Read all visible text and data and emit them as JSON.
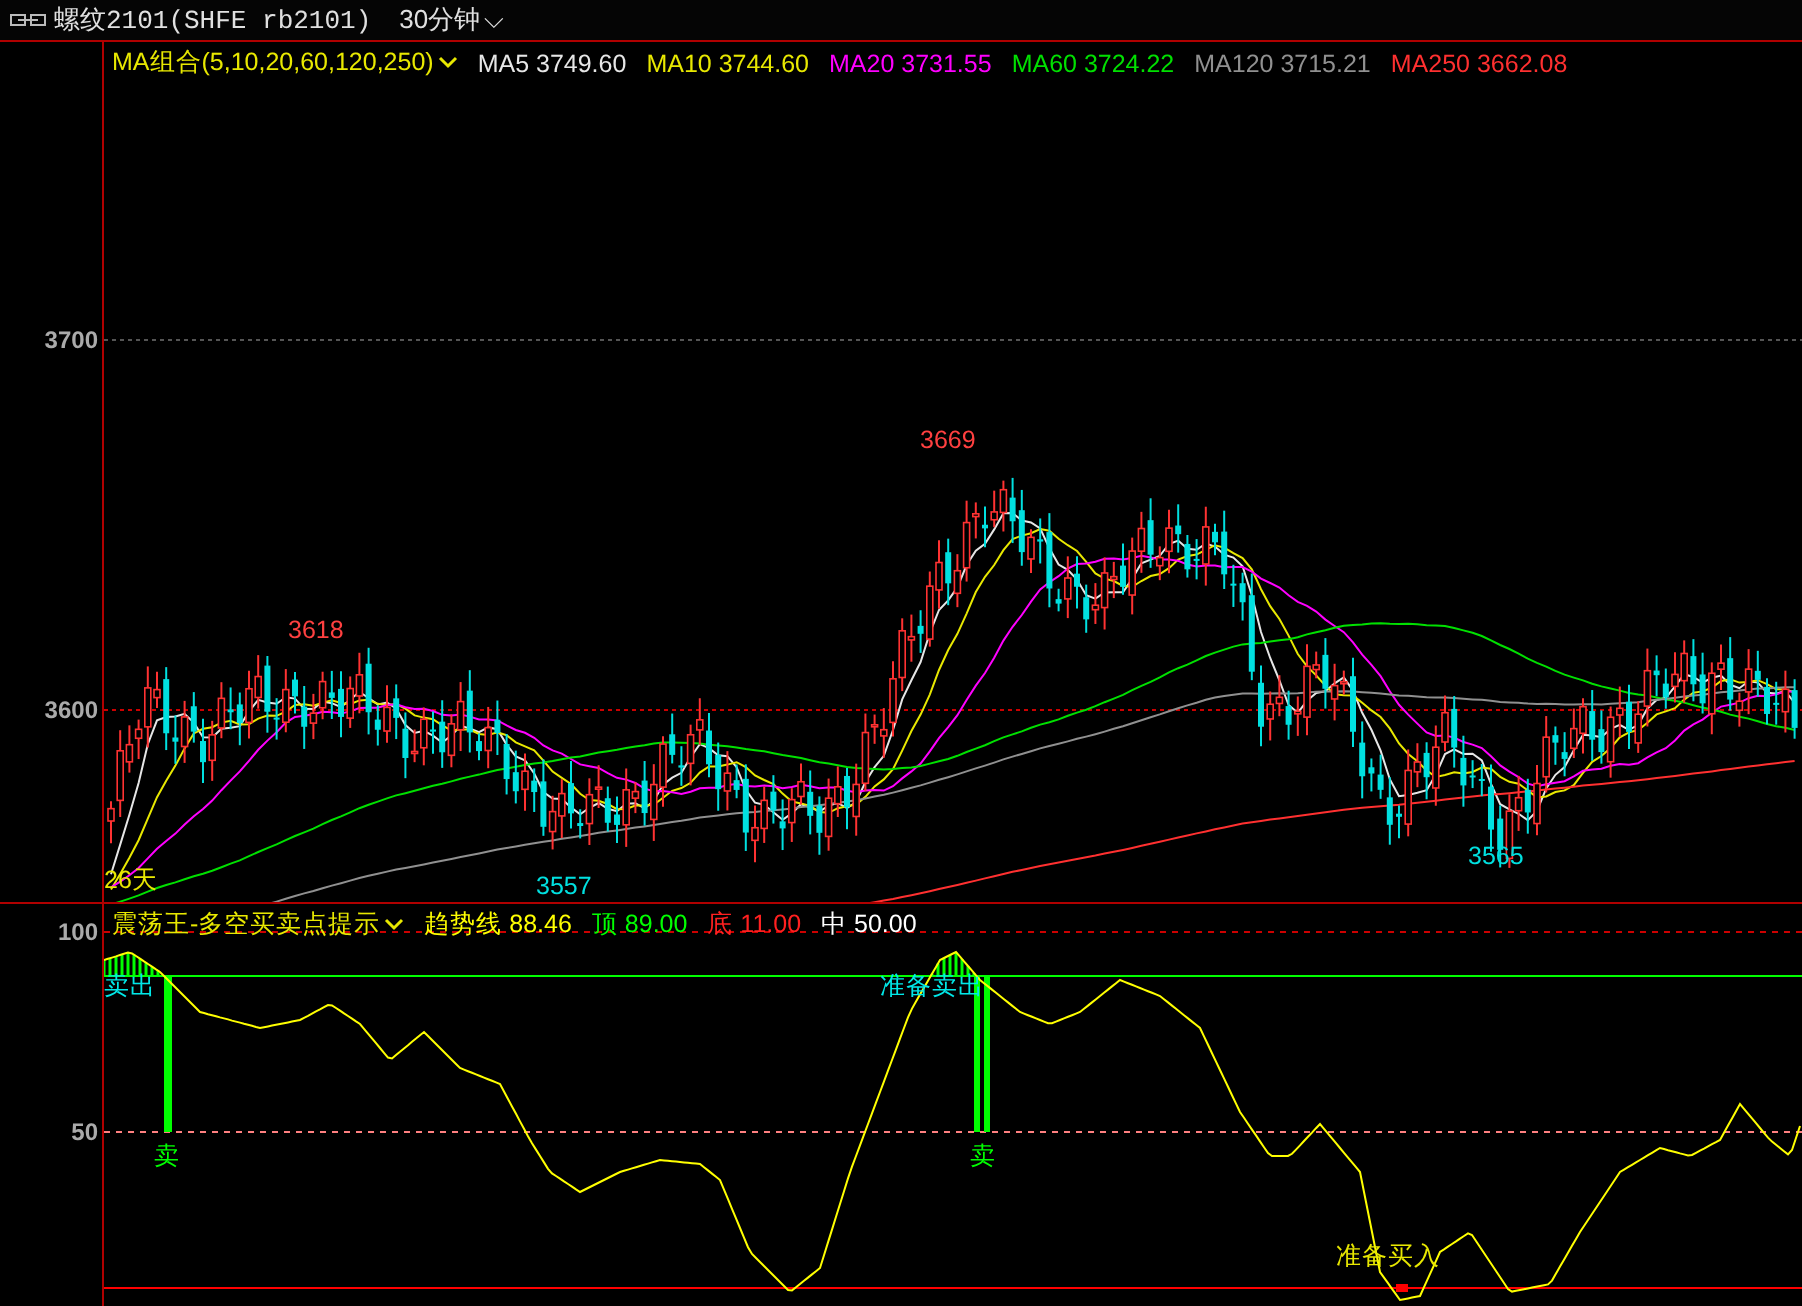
{
  "title_bar": {
    "instrument": "螺纹2101(SHFE rb2101)",
    "period": "30分钟",
    "caret": "⌵"
  },
  "main_chart": {
    "indicator": "MA组合(5,10,20,60,120,250)",
    "ma_values": [
      {
        "label": "MA5",
        "value": "3749.60",
        "color": "#e6e6e6"
      },
      {
        "label": "MA10",
        "value": "3744.60",
        "color": "#e8e800"
      },
      {
        "label": "MA20",
        "value": "3731.55",
        "color": "#ff00ff"
      },
      {
        "label": "MA60",
        "value": "3724.22",
        "color": "#00e000"
      },
      {
        "label": "MA120",
        "value": "3715.21",
        "color": "#909090"
      },
      {
        "label": "MA250",
        "value": "3662.08",
        "color": "#ff3030"
      }
    ],
    "y_ticks": [
      "3700",
      "3600"
    ],
    "price_labels": [
      {
        "text": "3669",
        "kind": "high"
      },
      {
        "text": "3618",
        "kind": "high"
      },
      {
        "text": "3557",
        "kind": "low"
      },
      {
        "text": "3565",
        "kind": "low"
      },
      {
        "text": "26天",
        "kind": "note"
      }
    ]
  },
  "sub_chart": {
    "indicator": "震荡王-多空买卖点提示",
    "values": [
      {
        "label": "趋势线",
        "value": "88.46",
        "color": "#ffff00"
      },
      {
        "label": "顶",
        "value": "89.00",
        "color": "#00ff00"
      },
      {
        "label": "底",
        "value": "11.00",
        "color": "#ff2020"
      },
      {
        "label": "中",
        "value": "50.00",
        "color": "#ffffff"
      }
    ],
    "y_ticks": [
      "100",
      "50"
    ],
    "signals": [
      {
        "text": "卖出",
        "kind": "prepare-sell"
      },
      {
        "text": "准备卖出",
        "kind": "prepare-sell"
      },
      {
        "text": "卖",
        "kind": "sell"
      },
      {
        "text": "卖",
        "kind": "sell"
      },
      {
        "text": "准备买入",
        "kind": "prepare-buy"
      }
    ]
  }
}
